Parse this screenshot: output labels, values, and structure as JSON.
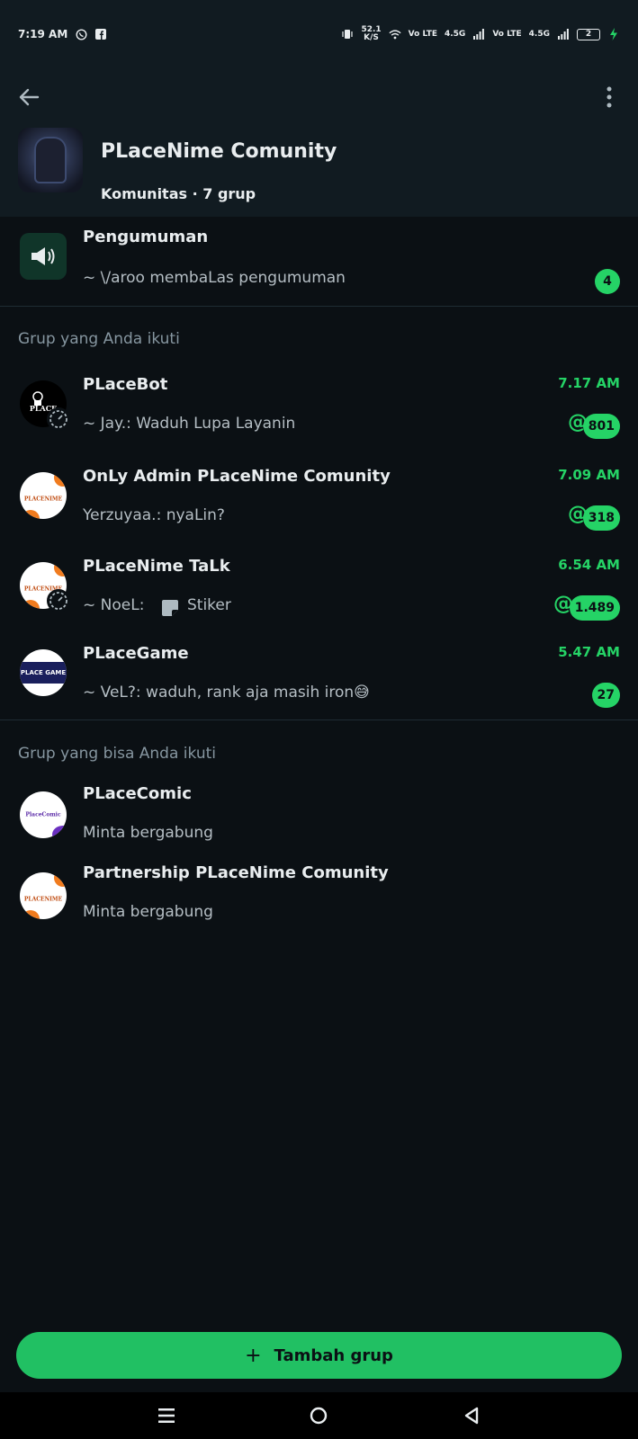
{
  "status_bar": {
    "time": "7:19 AM",
    "speed_value": "52.1",
    "speed_unit": "K/S",
    "net1": "Vo LTE",
    "net1_type": "4.5G",
    "net2": "Vo LTE",
    "net2_type": "4.5G",
    "battery": "2"
  },
  "header": {
    "title": "PLaceNime Comunity",
    "meta": "Komunitas · 7 grup"
  },
  "announcement": {
    "title": "Pengumuman",
    "preview": "~ \\/aroo membaLas pengumuman",
    "unread": "4"
  },
  "joined_section": {
    "label": "Grup yang Anda ikuti",
    "groups": [
      {
        "name": "PLaceBot",
        "preview": "~ Jay.: Waduh Lupa Layanin",
        "time": "7.17 AM",
        "mention": "@",
        "unread": "801"
      },
      {
        "name": "OnLy Admin PLaceNime Comunity",
        "preview": "Yerzuyaa.: nyaLin?",
        "time": "7.09 AM",
        "mention": "@",
        "unread": "318"
      },
      {
        "name": "PLaceNime TaLk",
        "preview_prefix": "~ NoeL:",
        "preview": "Stiker",
        "time": "6.54 AM",
        "mention": "@",
        "unread": "1.489"
      },
      {
        "name": "PLaceGame",
        "preview": "~ VeL?: waduh, rank aja masih iron",
        "emoji": "😅",
        "time": "5.47 AM",
        "unread": "27"
      }
    ]
  },
  "available_section": {
    "label": "Grup yang bisa Anda ikuti",
    "groups": [
      {
        "name": "PLaceComic",
        "preview": "Minta bergabung"
      },
      {
        "name": "Partnership PLaceNime Comunity",
        "preview": "Minta bergabung"
      }
    ]
  },
  "avatars": {
    "placebot": "PLACE",
    "placenime": "PLACENIME",
    "placegame": "PLACE GAME",
    "placecomic": "PlaceComic"
  },
  "add_group": {
    "icon": "+",
    "label": "Tambah grup"
  },
  "colors": {
    "accent": "#25d366",
    "background": "#0b1014",
    "header": "#111b21"
  }
}
